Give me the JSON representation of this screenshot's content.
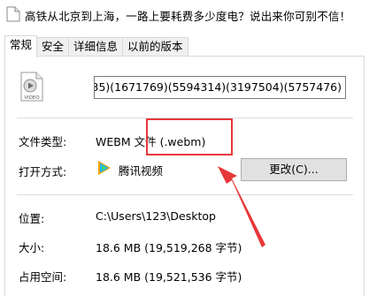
{
  "window": {
    "title": "高铁从北京到上海，一路上要耗费多少度电？说出来你可别不信！"
  },
  "tabs": [
    {
      "label": "常规",
      "active": true
    },
    {
      "label": "安全",
      "active": false
    },
    {
      "label": "详细信息",
      "active": false
    },
    {
      "label": "以前的版本",
      "active": false
    }
  ],
  "file": {
    "icon": "video-file-icon",
    "icon_caption": "VIDEO",
    "name_value": "3434735)(1671769)(5594314)(3197504)(5757476)"
  },
  "properties": {
    "file_type_label": "文件类型:",
    "file_type_value": "WEBM 文件 (.webm)",
    "open_with_label": "打开方式:",
    "open_with_app": "腾讯视频",
    "open_with_app_icon": "tencent-video-icon",
    "change_button": "更改(C)...",
    "location_label": "位置:",
    "location_value": "C:\\Users\\123\\Desktop",
    "size_label": "大小:",
    "size_value": "18.6 MB (19,519,268 字节)",
    "size_on_disk_label": "占用空间:",
    "size_on_disk_value": "18.6 MB (19,521,536 字节)"
  },
  "annotation": {
    "color": "#e8373a"
  }
}
